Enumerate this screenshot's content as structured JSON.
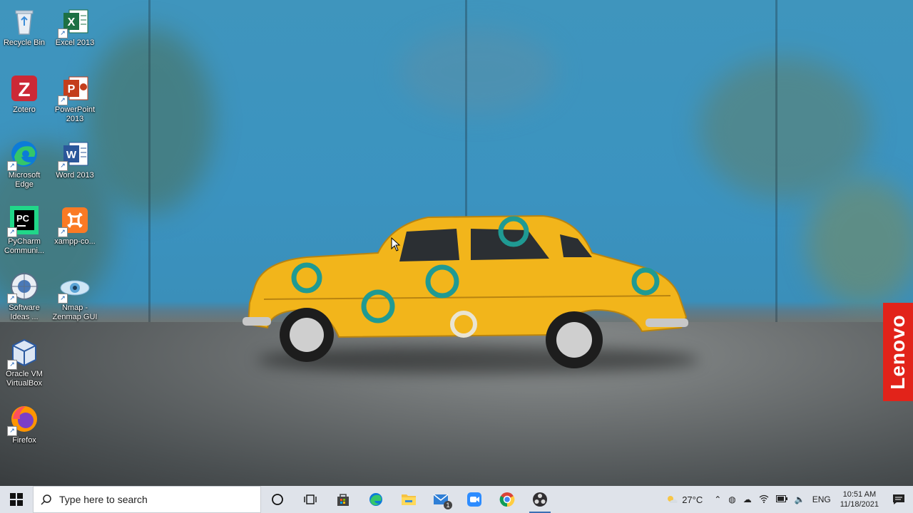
{
  "desktop": {
    "icons": [
      {
        "label": "Recycle Bin",
        "icon": "recycle-bin-icon"
      },
      {
        "label": "Excel 2013",
        "icon": "excel-icon"
      },
      {
        "label": "Zotero",
        "icon": "zotero-icon"
      },
      {
        "label": "PowerPoint 2013",
        "icon": "powerpoint-icon"
      },
      {
        "label": "Microsoft Edge",
        "icon": "edge-icon"
      },
      {
        "label": "Word 2013",
        "icon": "word-icon"
      },
      {
        "label": "PyCharm Communi...",
        "icon": "pycharm-icon"
      },
      {
        "label": "xampp-co...",
        "icon": "xampp-icon"
      },
      {
        "label": "Software Ideas ...",
        "icon": "software-ideas-icon"
      },
      {
        "label": "Nmap - Zenmap GUI",
        "icon": "nmap-icon"
      },
      {
        "label": "Oracle VM VirtualBox",
        "icon": "virtualbox-icon"
      },
      {
        "label": "Firefox",
        "icon": "firefox-icon"
      }
    ],
    "brand_tab": "Lenovo"
  },
  "taskbar": {
    "search_placeholder": "Type here to search",
    "weather": "27°C",
    "language": "ENG",
    "time": "10:51 AM",
    "date": "11/18/2021",
    "mail_badge": "1",
    "pinned": [
      "cortana-icon",
      "task-view-icon",
      "store-icon",
      "edge-icon",
      "file-explorer-icon",
      "mail-icon",
      "zoom-icon",
      "chrome-icon",
      "obs-icon"
    ]
  },
  "colors": {
    "taskbar_bg": "#dfe3ea",
    "lenovo_red": "#e2231a",
    "wall_blue": "#3b93c0",
    "car_yellow": "#f2b51b"
  }
}
